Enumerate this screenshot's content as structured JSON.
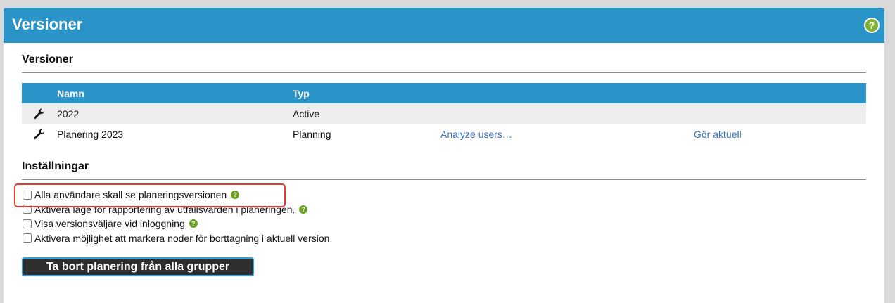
{
  "header": {
    "title": "Versioner",
    "help_icon": "question-icon",
    "help_glyph": "?"
  },
  "versions_section": {
    "title": "Versioner",
    "columns": [
      "",
      "Namn",
      "Typ",
      "",
      ""
    ],
    "rows": [
      {
        "icon": "wrench-icon",
        "name": "2022",
        "type": "Active",
        "action1": "",
        "action2": ""
      },
      {
        "icon": "wrench-icon",
        "name": "Planering 2023",
        "type": "Planning",
        "action1": "Analyze users…",
        "action2": "Gör aktuell"
      }
    ]
  },
  "settings_section": {
    "title": "Inställningar",
    "help_glyph": "?",
    "options": [
      {
        "label": "Alla användare skall se planeringsversionen",
        "checked": false,
        "help": true,
        "highlighted": true
      },
      {
        "label": "Aktivera läge för rapportering av utfallsvärden i planeringen.",
        "checked": false,
        "help": true
      },
      {
        "label": "Visa versionsväljare vid inloggning",
        "checked": false,
        "help": true
      },
      {
        "label": "Aktivera möjlighet att markera noder för borttagning i aktuell version",
        "checked": false,
        "help": false
      }
    ]
  },
  "remove_button": {
    "label": "Ta bort planering från alla grupper"
  },
  "colors": {
    "accent": "#2a94c8",
    "help": "#6aa023",
    "highlight": "#e53935"
  }
}
